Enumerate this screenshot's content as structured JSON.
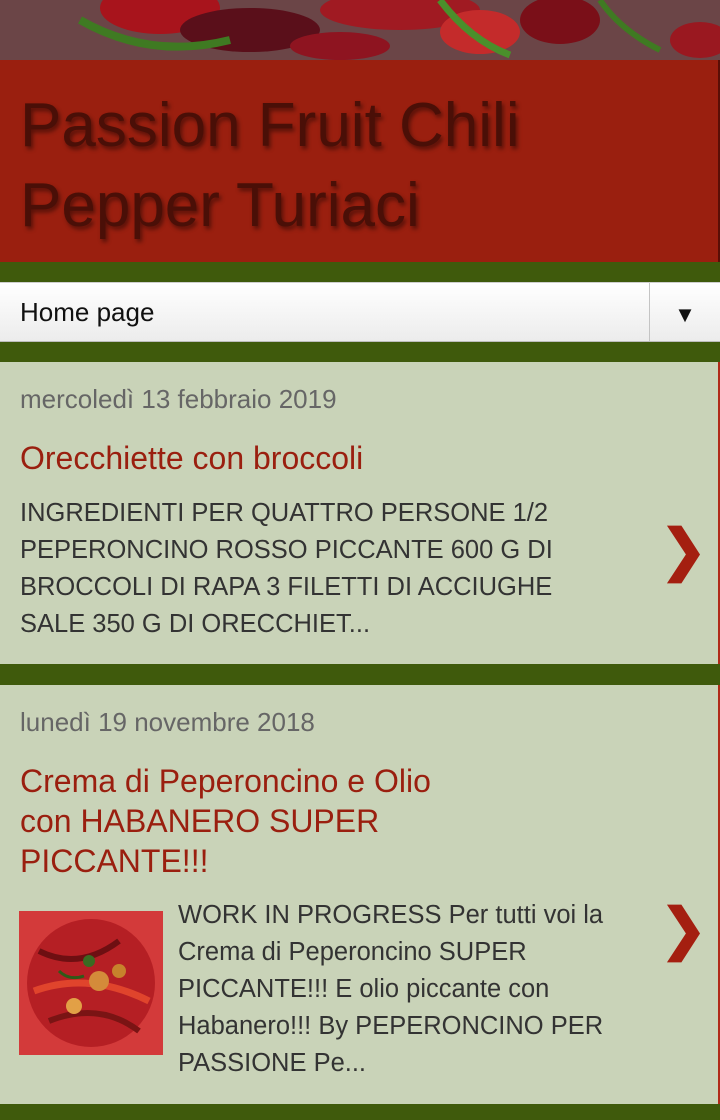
{
  "header": {
    "banner_image": "red chili peppers photo",
    "site_title": "Passion Fruit Chili Pepper Turiaci"
  },
  "nav": {
    "label": "Home page",
    "dropdown_icon": "▼"
  },
  "posts": [
    {
      "date": "mercoledì 13 febbraio 2019",
      "title": "Orecchiette con broccoli",
      "snippet": "INGREDIENTI PER QUATTRO PERSONE 1/2 PEPERONCINO ROSSO PICCANTE 600 G DI BROCCOLI DI RAPA 3 FILETTI DI ACCIUGHE SALE 350 G DI ORECCHIET...",
      "chevron": "❯"
    },
    {
      "date": "lunedì 19 novembre 2018",
      "title": "Crema di Peperoncino e Olio con HABANERO SUPER PICCANTE!!!",
      "snippet": "WORK IN PROGRESS  Per tutti voi la Crema di Peperoncino SUPER PICCANTE!!! E olio piccante con Habanero!!! By PEPERONCINO PER PASSIONE Pe...",
      "thumbnail": "bowl of red chili peppers",
      "chevron": "❯"
    }
  ],
  "colors": {
    "header_bg": "#9a1f0f",
    "page_bg": "#3f5a0c",
    "post_bg": "#c9d3b8",
    "title_color": "#9a1f0f"
  }
}
